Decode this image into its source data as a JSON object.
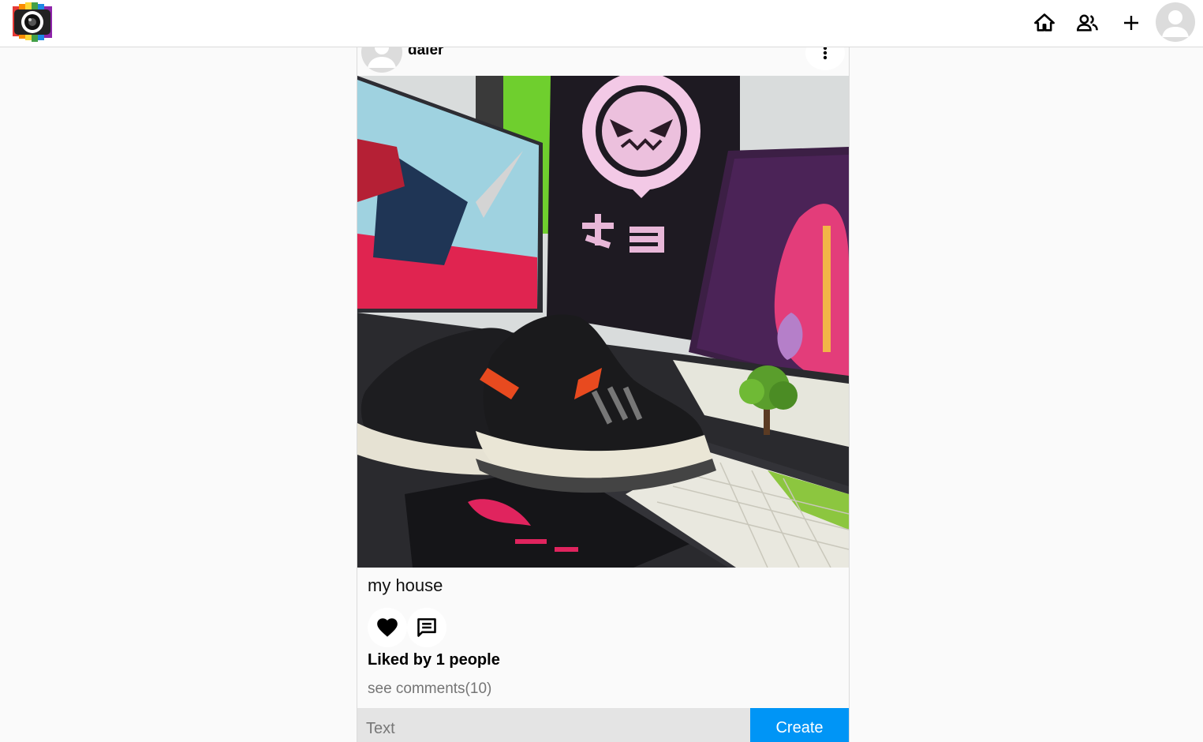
{
  "app": {
    "logo_icon": "camera-logo-icon"
  },
  "nav": {
    "home_icon": "home-icon",
    "friends_icon": "people-icon",
    "create_icon": "plus-icon",
    "profile_icon": "user-avatar-icon"
  },
  "post": {
    "username": "daler",
    "caption": "my house",
    "likes_text": "Liked by 1 people",
    "comments_link": "see comments(10)",
    "like_icon": "heart-icon",
    "comment_icon": "comment-icon",
    "more_icon": "more-vertical-icon"
  },
  "comment_form": {
    "placeholder": "Text",
    "submit_label": "Create"
  },
  "colors": {
    "primary": "#0095f6",
    "background": "#fafafa",
    "input_bg": "#e4e4e4"
  }
}
